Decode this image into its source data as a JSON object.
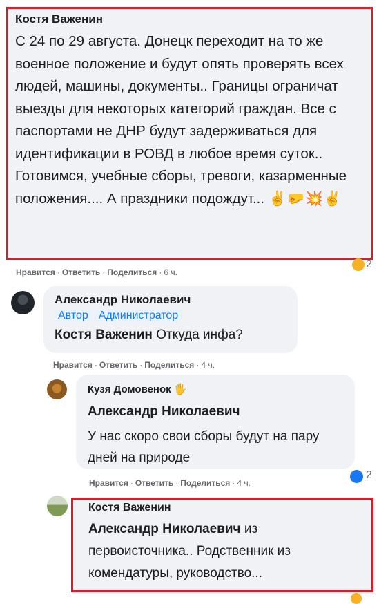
{
  "comment1": {
    "author": "Костя Важенин",
    "text": "С 24 по 29 августа. Донецк переходит на то же военное положение и будут опять проверять всех людей, машины, документы.. Границы ограничат выезды для некоторых категорий граждан. Все с паспортами не ДНР будут задерживаться для идентификации в РОВД в любое время суток.. Готовимся, учебные сборы, тревоги, казарменные положения.... А праздники подождут...",
    "emoji": "✌🤛💥✌",
    "actions": {
      "like": "Нравится",
      "reply": "Ответить",
      "share": "Поделиться",
      "time": "6 ч."
    },
    "reaction_count": "2"
  },
  "comment2": {
    "author": "Александр Николаевич",
    "badges": [
      "Автор",
      "Администратор"
    ],
    "mention": "Костя Важенин",
    "text": "Откуда инфа?",
    "actions": {
      "like": "Нравится",
      "reply": "Ответить",
      "share": "Поделиться",
      "time": "4 ч."
    }
  },
  "comment3": {
    "author": "Кузя Домовенок",
    "author_emoji": "🖐",
    "mention": "Александр Николаевич",
    "text": "У нас скоро свои сборы будут на пару дней на природе",
    "actions": {
      "like": "Нравится",
      "reply": "Ответить",
      "share": "Поделиться",
      "time": "4 ч."
    },
    "reaction_count": "2"
  },
  "comment4": {
    "author": "Костя Важенин",
    "mention": "Александр Николаевич",
    "text": "из первоисточника.. Родственник из комендатуры, руководство..."
  },
  "colors": {
    "highlight_border": "#d21f2c",
    "bubble": "#f0f2f5",
    "badge_text": "#1877f2",
    "like_blue": "#1877f2"
  }
}
